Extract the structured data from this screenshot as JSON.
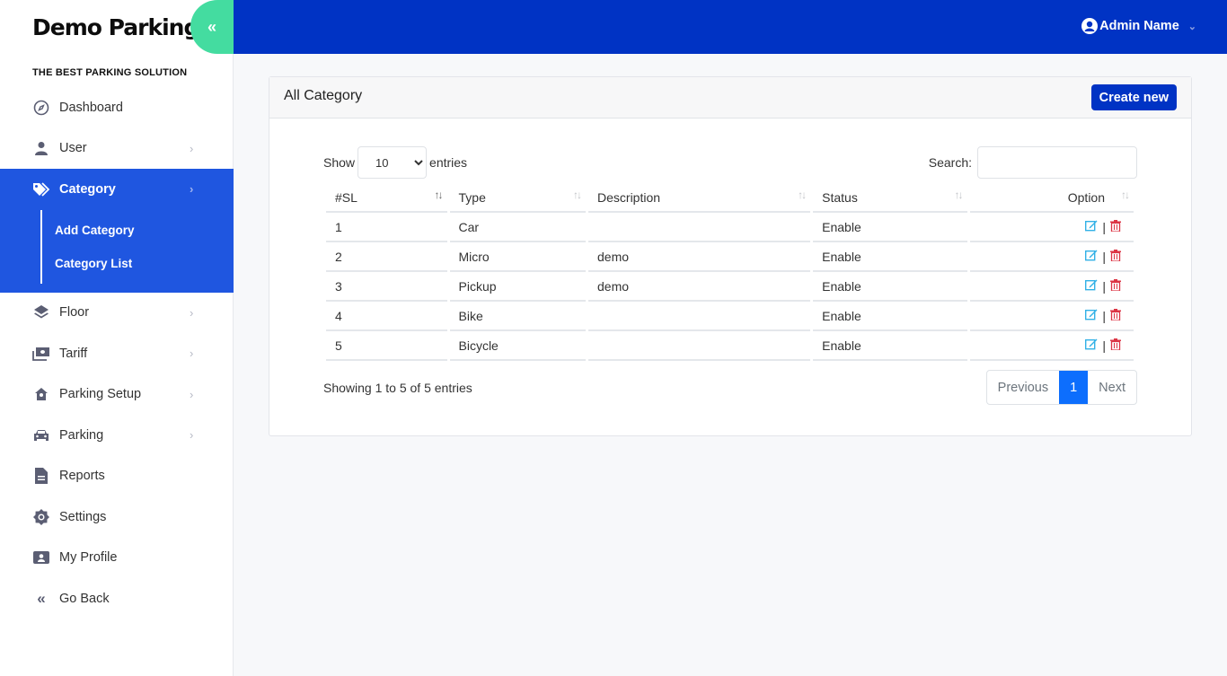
{
  "brand": {
    "name": "Demo Parking",
    "tagline": "THE BEST PARKING SOLUTION",
    "collapse_icon": "«"
  },
  "colors": {
    "topbar": "#0033c4",
    "sidebar_active": "#1f56e0",
    "collapse": "#44dca0",
    "edit": "#32b1e6",
    "delete": "#dc3545",
    "page_active": "#0d6efd"
  },
  "header": {
    "user_name": "Admin Name"
  },
  "sidebar": {
    "items": [
      {
        "label": "Dashboard",
        "icon": "compass-icon"
      },
      {
        "label": "User",
        "icon": "user-icon"
      },
      {
        "label": "Category",
        "icon": "tags-icon"
      },
      {
        "label": "Floor",
        "icon": "layers-icon"
      },
      {
        "label": "Tariff",
        "icon": "money-icon"
      },
      {
        "label": "Parking Setup",
        "icon": "house-icon"
      },
      {
        "label": "Parking",
        "icon": "car-icon"
      },
      {
        "label": "Reports",
        "icon": "file-icon"
      },
      {
        "label": "Settings",
        "icon": "gear-icon"
      },
      {
        "label": "My Profile",
        "icon": "id-card-icon"
      },
      {
        "label": "Go Back",
        "icon": "double-chevron-left-icon"
      }
    ],
    "category_sub": [
      "Add Category",
      "Category List"
    ]
  },
  "card": {
    "title": "All Category",
    "create_label": "Create new",
    "show_label": "Show",
    "entries_label": "entries",
    "page_length": "10",
    "search_label": "Search:",
    "search_value": "",
    "columns": [
      "#SL",
      "Type",
      "Description",
      "Status",
      "Option"
    ],
    "rows": [
      {
        "sl": "1",
        "type": "Car",
        "description": "",
        "status": "Enable"
      },
      {
        "sl": "2",
        "type": "Micro",
        "description": "demo",
        "status": "Enable"
      },
      {
        "sl": "3",
        "type": "Pickup",
        "description": "demo",
        "status": "Enable"
      },
      {
        "sl": "4",
        "type": "Bike",
        "description": "",
        "status": "Enable"
      },
      {
        "sl": "5",
        "type": "Bicycle",
        "description": "",
        "status": "Enable"
      }
    ],
    "info": "Showing 1 to 5 of 5 entries",
    "pagination": {
      "previous": "Previous",
      "current": "1",
      "next": "Next"
    }
  }
}
